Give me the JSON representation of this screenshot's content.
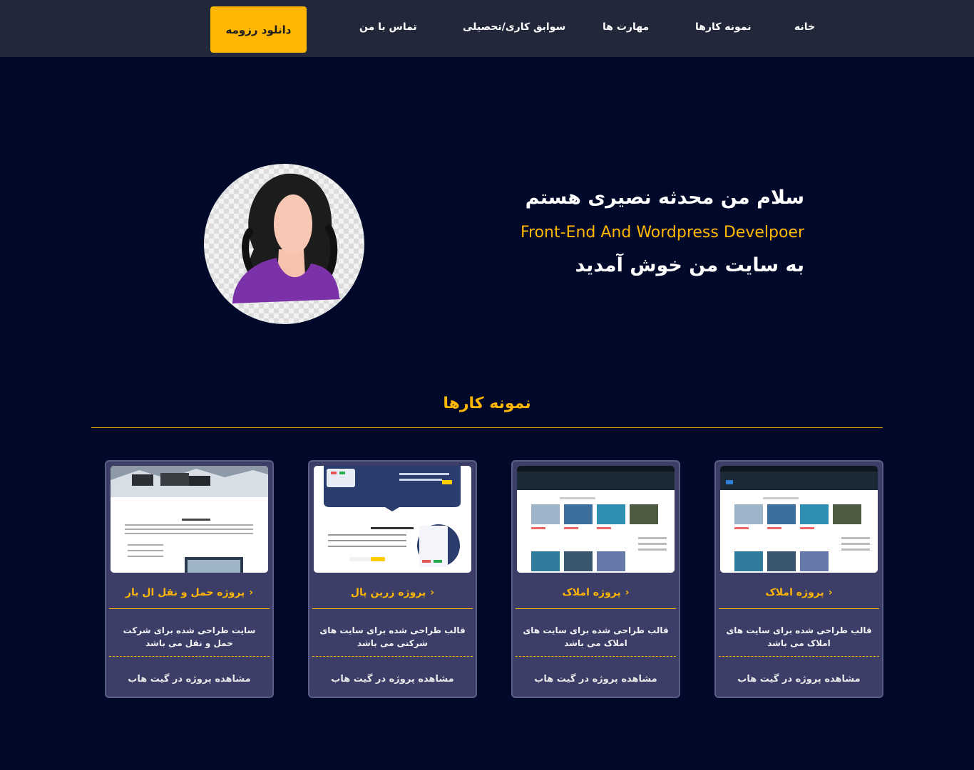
{
  "nav": {
    "home": "خانه",
    "portfolio": "نمونه کارها",
    "skills": "مهارت ها",
    "experience": "سوابق کاری/تحصیلی",
    "contact": "تماس با من",
    "download_resume": "دانلود رزومه"
  },
  "hero": {
    "greeting": "سلام من محدثه نصیری هستم",
    "role": "Front-End And Wordpress Develpoer",
    "welcome": "به سایت من خوش آمدید"
  },
  "portfolio": {
    "title": "نمونه کارها",
    "cards": [
      {
        "title": "پروژه املاک",
        "description": "قالب طراحی شده برای سایت های املاک می باشد",
        "link": "مشاهده پروژه در گیت هاب"
      },
      {
        "title": "پروژه املاک",
        "description": "قالب طراحی شده برای سایت های املاک می باشد",
        "link": "مشاهده پروژه در گیت هاب"
      },
      {
        "title": "پروژه زرین پال",
        "description": "قالب طراحی شده برای سایت های شرکتی می باشد",
        "link": "مشاهده پروژه در گیت هاب"
      },
      {
        "title": "پروژه حمل و نقل ال بار",
        "description": "سایت طراحی شده برای شرکت حمل و نقل می باشد",
        "link": "مشاهده پروژه در گیت هاب"
      }
    ]
  },
  "colors": {
    "accent": "#ffb703",
    "background": "#01092a",
    "navbar": "#22283a",
    "card": "#3c3e67"
  }
}
